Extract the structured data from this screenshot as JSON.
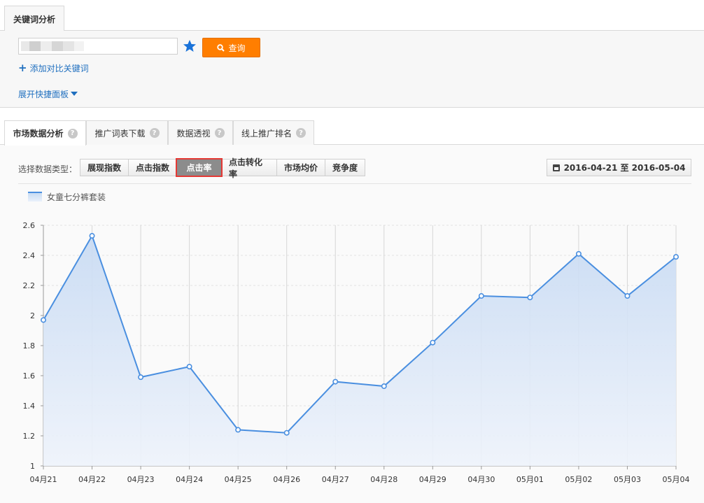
{
  "top_tab": {
    "label": "关键词分析"
  },
  "search": {
    "value": "",
    "query_label": "查询"
  },
  "add_compare_label": "添加对比关键词",
  "expand_panel_label": "展开快捷面板",
  "sub_tabs": [
    {
      "label": "市场数据分析",
      "active": true
    },
    {
      "label": "推广词表下载",
      "active": false
    },
    {
      "label": "数据透视",
      "active": false
    },
    {
      "label": "线上推广排名",
      "active": false
    }
  ],
  "data_type": {
    "label": "选择数据类型：",
    "options": [
      "展现指数",
      "点击指数",
      "点击率",
      "点击转化率",
      "市场均价",
      "竞争度"
    ],
    "selected": "点击率"
  },
  "date_range": "2016-04-21 至 2016-05-04",
  "colors": {
    "accent": "#ff7e00",
    "link": "#1f6fbf",
    "line": "#4a8fe0",
    "highlight": "#e53935"
  },
  "chart_data": {
    "type": "area",
    "legend": [
      "女童七分裤套装"
    ],
    "categories": [
      "04月21",
      "04月22",
      "04月23",
      "04月24",
      "04月25",
      "04月26",
      "04月27",
      "04月28",
      "04月29",
      "04月30",
      "05月01",
      "05月02",
      "05月03",
      "05月04"
    ],
    "series": [
      {
        "name": "女童七分裤套装",
        "values": [
          1.97,
          2.53,
          1.59,
          1.66,
          1.24,
          1.22,
          1.56,
          1.53,
          1.82,
          2.13,
          2.12,
          2.41,
          2.13,
          2.39
        ]
      }
    ],
    "ylim": [
      1,
      2.6
    ],
    "yticks": [
      "1",
      "1.2",
      "1.4",
      "1.6",
      "1.8",
      "2",
      "2.2",
      "2.4",
      "2.6"
    ],
    "grid": true
  }
}
